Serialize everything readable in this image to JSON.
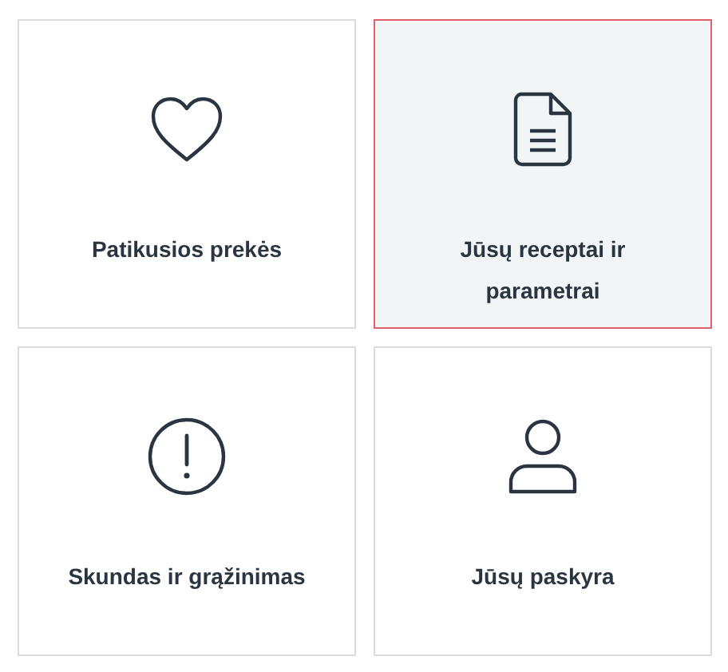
{
  "cards": [
    {
      "kind": "heart",
      "label": "Patikusios prekės",
      "selected": false
    },
    {
      "kind": "document",
      "label": "Jūsų receptai ir parametrai",
      "selected": true
    },
    {
      "kind": "alert",
      "label": "Skundas ir grąžinimas",
      "selected": false
    },
    {
      "kind": "person",
      "label": "Jūsų paskyra",
      "selected": false
    }
  ]
}
